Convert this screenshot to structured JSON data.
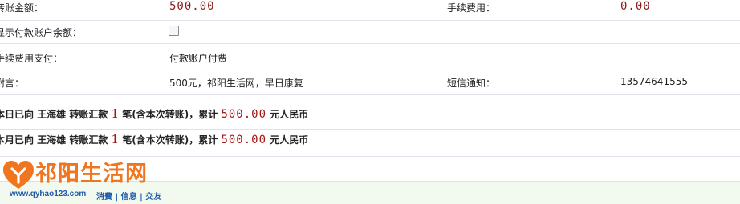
{
  "transfer": {
    "amount_label": "转账金额：",
    "amount_value": "500.00",
    "fee_label": "手续费用：",
    "fee_value": "0.00",
    "show_balance_label": "显示付款账户余额：",
    "fee_payment_label": "手续费用支付：",
    "fee_payment_value": "付款账户付费",
    "message_label": "附言：",
    "message_value": "500元，祁阳生活网，早日康复",
    "sms_label": "短信通知：",
    "sms_value": "13574641555"
  },
  "summary": {
    "today": {
      "prefix": "本日已向 王海雄 转账汇款",
      "count": "1",
      "middle": "笔(含本次转账)，累计",
      "total": "500.00",
      "suffix": "元人民币"
    },
    "month": {
      "prefix": "本月已向 王海雄 转账汇款",
      "count": "1",
      "middle": "笔(含本次转账)，累计",
      "total": "500.00",
      "suffix": "元人民币"
    }
  },
  "watermark": {
    "logo_text": "祁阳生活网",
    "url": "www.qyhao123.com",
    "tags": "消費 | 信息 | 交友",
    "brand_color": "#f0751e",
    "url_color": "#1f5aa8"
  }
}
